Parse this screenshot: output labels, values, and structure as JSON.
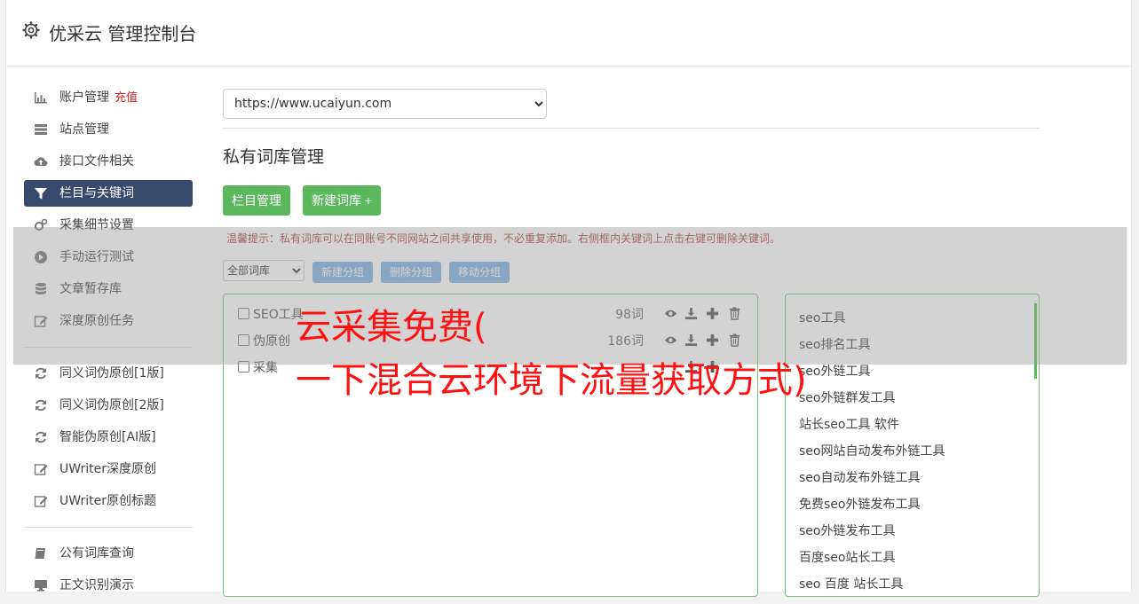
{
  "header": {
    "title": "优采云 管理控制台",
    "icon": "gear-icon"
  },
  "sidebar": {
    "recharge": "充值",
    "items": [
      {
        "label": "账户管理",
        "icon": "bar-chart-icon"
      },
      {
        "label": "站点管理",
        "icon": "server-icon"
      },
      {
        "label": "接口文件相关",
        "icon": "cloud-upload-icon"
      },
      {
        "label": "栏目与关键词",
        "icon": "filter-icon",
        "active": true
      },
      {
        "label": "采集细节设置",
        "icon": "cogs-icon"
      },
      {
        "label": "手动运行测试",
        "icon": "play-circle-icon"
      },
      {
        "label": "文章暂存库",
        "icon": "database-icon"
      },
      {
        "label": "深度原创任务",
        "icon": "edit-icon"
      },
      {
        "label": "同义词伪原创[1版]",
        "icon": "refresh-icon"
      },
      {
        "label": "同义词伪原创[2版]",
        "icon": "refresh-icon"
      },
      {
        "label": "智能伪原创[AI版]",
        "icon": "refresh-icon"
      },
      {
        "label": "UWriter深度原创",
        "icon": "edit-icon"
      },
      {
        "label": "UWriter原创标题",
        "icon": "edit-icon"
      },
      {
        "label": "公有词库查询",
        "icon": "book-icon"
      },
      {
        "label": "正文识别演示",
        "icon": "monitor-icon"
      }
    ]
  },
  "main": {
    "site_select": "https://www.ucaiyun.com",
    "section_title": "私有词库管理",
    "btn_column": "栏目管理",
    "btn_new_lib": "新建词库 +",
    "tip": "温馨提示：私有词库可以在同账号不同网站之间共享使用，不必重复添加。右侧框内关键词上点击右键可删除关键词。",
    "group_select": "全部词库",
    "btn_new_group": "新建分组",
    "btn_delete_group": "删除分组",
    "btn_move_group": "移动分组",
    "libraries": [
      {
        "name": "SEO工具",
        "count": "98词"
      },
      {
        "name": "伪原创",
        "count": "186词"
      },
      {
        "name": "采集",
        "count": ""
      }
    ],
    "keywords": [
      "seo工具",
      "seo排名工具",
      "seo外链工具",
      "seo外链群发工具",
      "站长seo工具 软件",
      "seo网站自动发布外链工具",
      "seo自动发布外链工具",
      "免费seo外链发布工具",
      "seo外链发布工具",
      "百度seo站长工具",
      "seo 百度 站长工具"
    ]
  },
  "overlay": {
    "line1": "云采集免费(",
    "line2": "一下混合云环境下流量获取方式)"
  },
  "colors": {
    "active_nav": "#384a6b",
    "green": "#5cb85c",
    "blue_btn": "#7fb0e0",
    "overlay_text": "#ff1111",
    "tip": "#a94442"
  }
}
